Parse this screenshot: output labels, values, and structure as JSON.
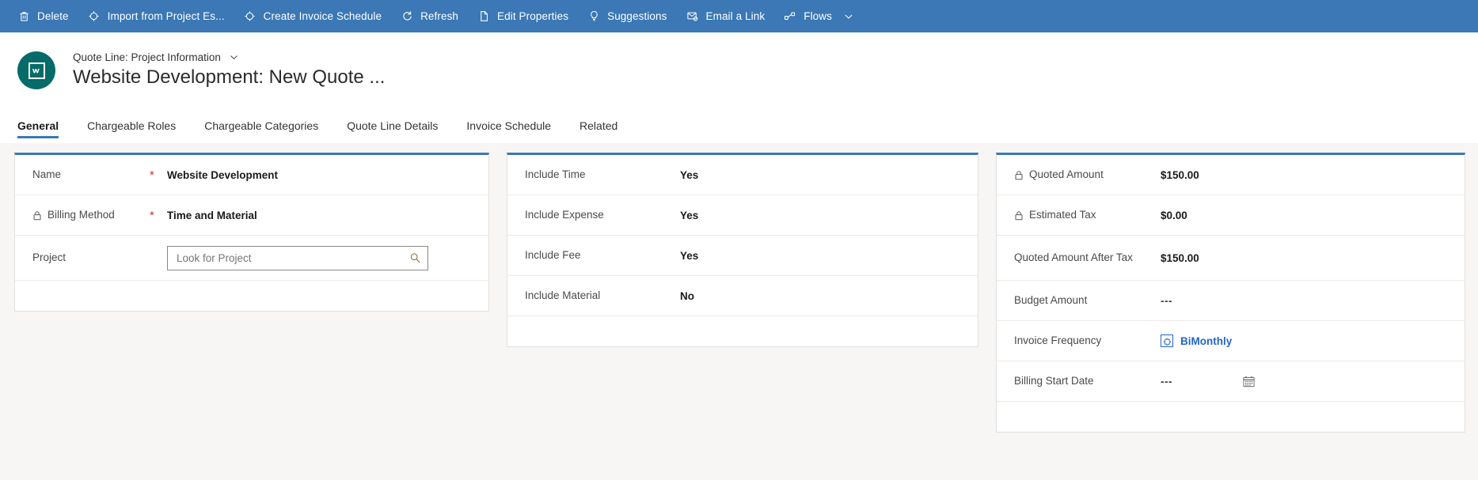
{
  "theme": {
    "commandbar_bg": "#3b78b5",
    "accent": "#3b78b5",
    "avatar_bg": "#046b68",
    "canvas_bg": "#f7f6f5",
    "required_color": "#c8372d",
    "link_color": "#2266c9"
  },
  "commandbar": {
    "items": [
      {
        "label": "Delete",
        "icon": "trash-icon"
      },
      {
        "label": "Import from Project Es...",
        "icon": "import-icon"
      },
      {
        "label": "Create Invoice Schedule",
        "icon": "create-schedule-icon"
      },
      {
        "label": "Refresh",
        "icon": "refresh-icon"
      },
      {
        "label": "Edit Properties",
        "icon": "edit-properties-icon"
      },
      {
        "label": "Suggestions",
        "icon": "lightbulb-icon"
      },
      {
        "label": "Email a Link",
        "icon": "email-link-icon"
      },
      {
        "label": "Flows",
        "icon": "flows-icon",
        "has_chevron": true
      }
    ]
  },
  "record_header": {
    "avatar_icon": "quote-line-entity-icon",
    "subtitle": "Quote Line: Project Information",
    "subtitle_chevron": "chevron-down-icon",
    "title": "Website Development: New Quote ..."
  },
  "tabs": [
    {
      "label": "General",
      "active": true
    },
    {
      "label": "Chargeable Roles",
      "active": false
    },
    {
      "label": "Chargeable Categories",
      "active": false
    },
    {
      "label": "Quote Line Details",
      "active": false
    },
    {
      "label": "Invoice Schedule",
      "active": false
    },
    {
      "label": "Related",
      "active": false
    }
  ],
  "form": {
    "column1": {
      "rows": [
        {
          "label": "Name",
          "locked": false,
          "required": "*",
          "value": "Website Development",
          "type": "text"
        },
        {
          "label": "Billing Method",
          "locked": true,
          "required": "*",
          "value": "Time and Material",
          "type": "text"
        },
        {
          "label": "Project",
          "locked": false,
          "required": "",
          "value": "",
          "placeholder": "Look for Project",
          "type": "lookup",
          "icon": "search-icon"
        }
      ]
    },
    "column2": {
      "rows": [
        {
          "label": "Include Time",
          "value": "Yes",
          "type": "text"
        },
        {
          "label": "Include Expense",
          "value": "Yes",
          "type": "text"
        },
        {
          "label": "Include Fee",
          "value": "Yes",
          "type": "text"
        },
        {
          "label": "Include Material",
          "value": "No",
          "type": "text"
        }
      ]
    },
    "column3": {
      "rows": [
        {
          "label": "Quoted Amount",
          "locked": true,
          "value": "$150.00",
          "type": "text"
        },
        {
          "label": "Estimated Tax",
          "locked": true,
          "value": "$0.00",
          "type": "text"
        },
        {
          "label": "Quoted Amount After Tax",
          "locked": false,
          "value": "$150.00",
          "type": "text"
        },
        {
          "label": "Budget Amount",
          "locked": false,
          "value": "---",
          "type": "dash"
        },
        {
          "label": "Invoice Frequency",
          "locked": false,
          "value": "BiMonthly",
          "type": "entity-link",
          "icon": "invoice-frequency-entity-icon"
        },
        {
          "label": "Billing Start Date",
          "locked": false,
          "value": "---",
          "type": "date",
          "icon": "calendar-icon"
        }
      ]
    }
  }
}
